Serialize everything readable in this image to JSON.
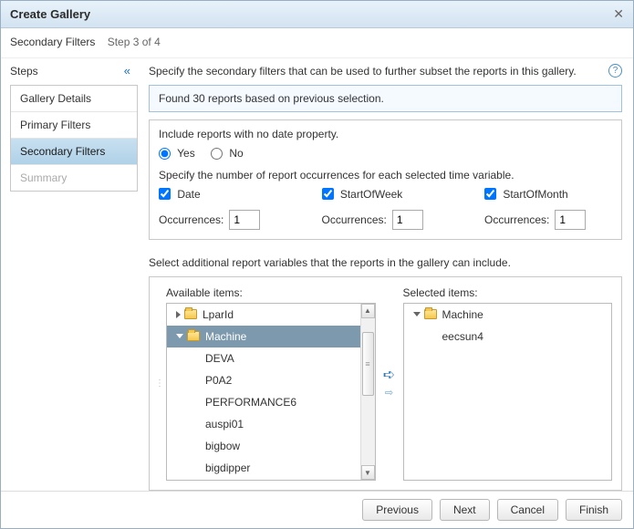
{
  "dialog": {
    "title": "Create Gallery",
    "subtitle": "Secondary Filters",
    "step_indicator": "Step 3 of 4"
  },
  "steps": {
    "header": "Steps",
    "items": [
      {
        "label": "Gallery Details",
        "state": "normal"
      },
      {
        "label": "Primary Filters",
        "state": "normal"
      },
      {
        "label": "Secondary Filters",
        "state": "selected"
      },
      {
        "label": "Summary",
        "state": "disabled"
      }
    ]
  },
  "main": {
    "instruction": "Specify the secondary filters that can be used to further subset the reports in this gallery.",
    "found_message": "Found 30 reports based on previous selection.",
    "include_no_date_label": "Include reports with no date property.",
    "radio_yes": "Yes",
    "radio_no": "No",
    "radio_selected": "yes",
    "occurrences_instruction": "Specify the number of report occurrences for each selected time variable.",
    "time_vars": [
      {
        "label": "Date",
        "checked": true,
        "occurrences": "1"
      },
      {
        "label": "StartOfWeek",
        "checked": true,
        "occurrences": "1"
      },
      {
        "label": "StartOfMonth",
        "checked": true,
        "occurrences": "1"
      }
    ],
    "occurrences_label": "Occurrences:",
    "select_additional_label": "Select additional report variables that the reports in the gallery can include.",
    "available_header": "Available items:",
    "selected_header": "Selected items:",
    "available_tree": [
      {
        "label": "LparId",
        "expanded": false
      },
      {
        "label": "Machine",
        "expanded": true,
        "selected": true,
        "children": [
          "DEVA",
          "P0A2",
          "PERFORMANCE6",
          "auspi01",
          "bigbow",
          "bigdipper"
        ]
      }
    ],
    "selected_tree": [
      {
        "label": "Machine",
        "expanded": true,
        "children": [
          "eecsun4"
        ]
      }
    ]
  },
  "footer": {
    "previous": "Previous",
    "next": "Next",
    "cancel": "Cancel",
    "finish": "Finish"
  }
}
